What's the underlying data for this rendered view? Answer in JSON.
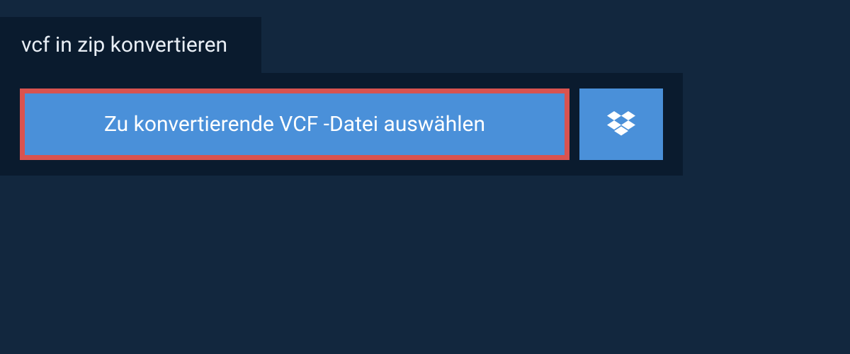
{
  "tab": {
    "title": "vcf in zip konvertieren"
  },
  "upload": {
    "select_label": "Zu konvertierende VCF -Datei auswählen"
  }
}
